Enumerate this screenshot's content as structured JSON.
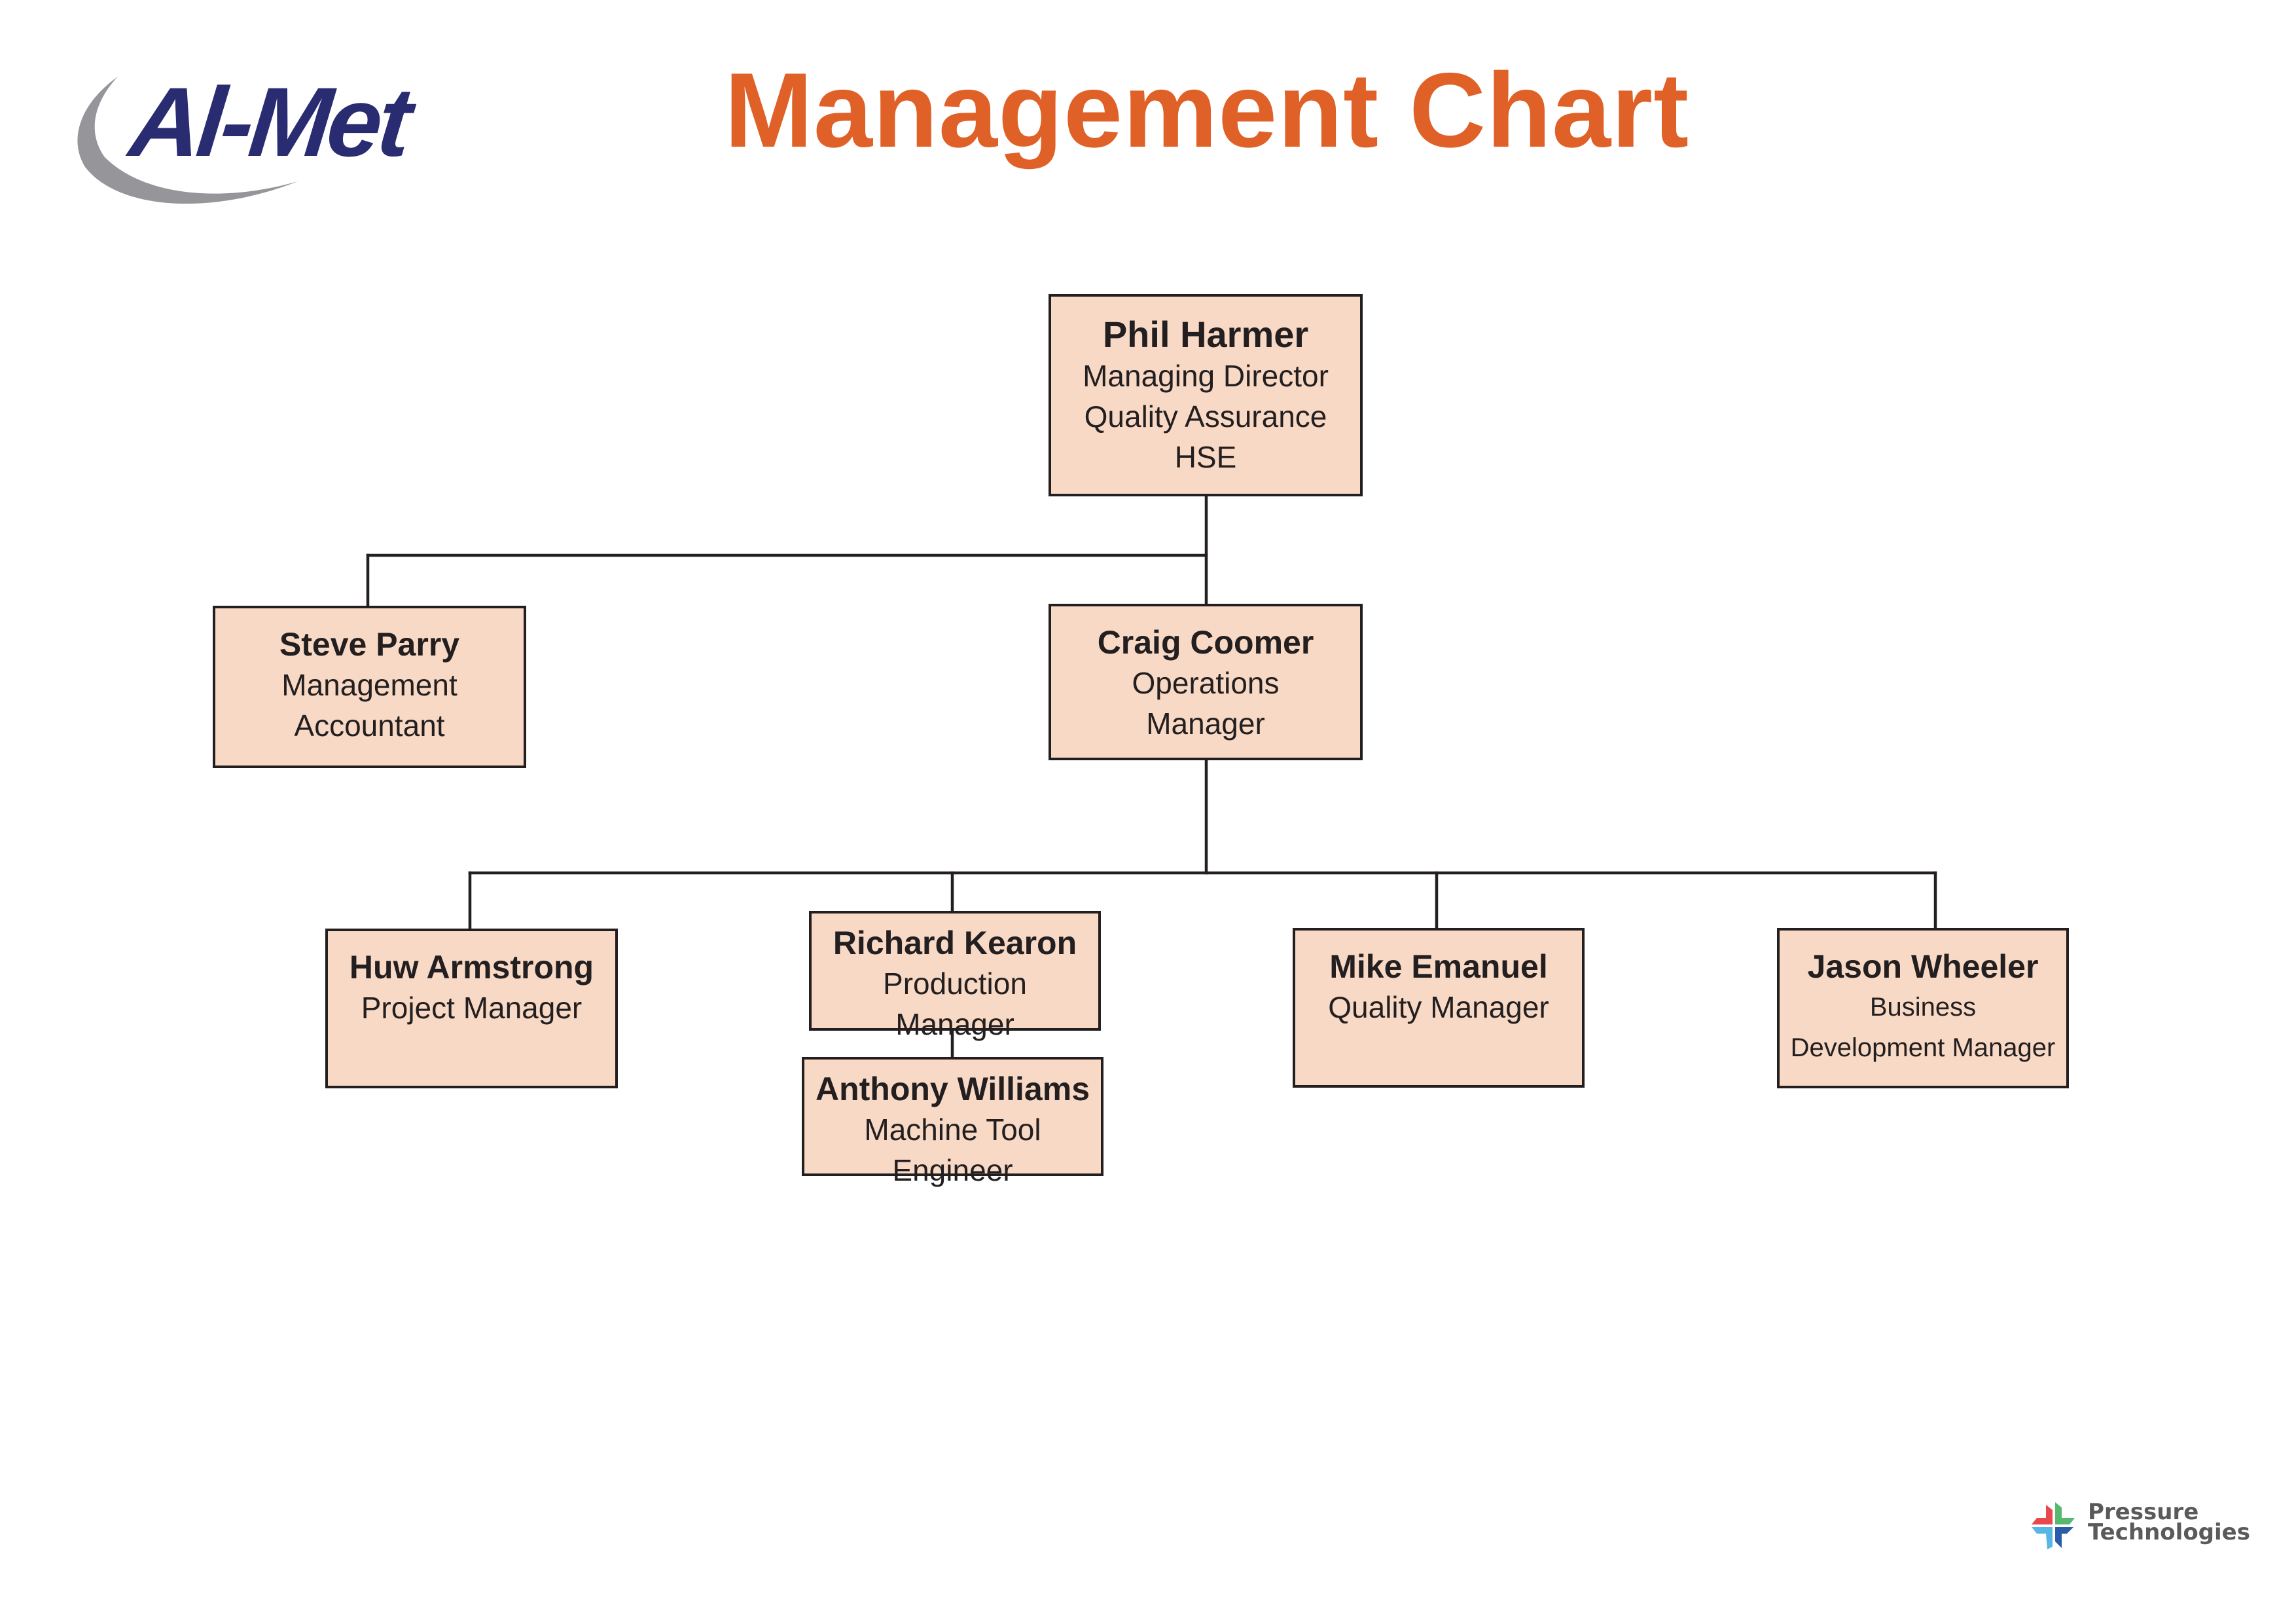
{
  "header": {
    "company_logo_text": "Al-Met",
    "title": "Management Chart"
  },
  "footer": {
    "partner_logo_line1": "Pressure",
    "partner_logo_line2": "Technologies"
  },
  "colors": {
    "title": "#E06128",
    "logo_navy": "#2A2C72",
    "logo_gray": "#96969A",
    "box_fill": "#F8D9C5",
    "box_stroke": "#231F20"
  },
  "org": {
    "phil": {
      "name": "Phil Harmer",
      "roles": [
        "Managing Director",
        "Quality Assurance",
        "HSE"
      ]
    },
    "steve": {
      "name": "Steve Parry",
      "roles": [
        "Management",
        "Accountant"
      ],
      "reports_to": "Phil Harmer"
    },
    "craig": {
      "name": "Craig Coomer",
      "roles": [
        "Operations",
        "Manager"
      ],
      "reports_to": "Phil Harmer"
    },
    "huw": {
      "name": "Huw Armstrong",
      "roles": [
        "Project Manager"
      ],
      "reports_to": "Craig Coomer"
    },
    "richard": {
      "name": "Richard Kearon",
      "roles": [
        "Production",
        "Manager"
      ],
      "reports_to": "Craig Coomer"
    },
    "anthony": {
      "name": "Anthony Williams",
      "roles": [
        "Machine Tool",
        "Engineer"
      ],
      "reports_to": "Richard Kearon"
    },
    "mike": {
      "name": "Mike Emanuel",
      "roles": [
        "Quality Manager"
      ],
      "reports_to": "Craig Coomer"
    },
    "jason": {
      "name": "Jason Wheeler",
      "roles": [
        "Business",
        "Development Manager"
      ],
      "reports_to": "Craig Coomer"
    }
  }
}
